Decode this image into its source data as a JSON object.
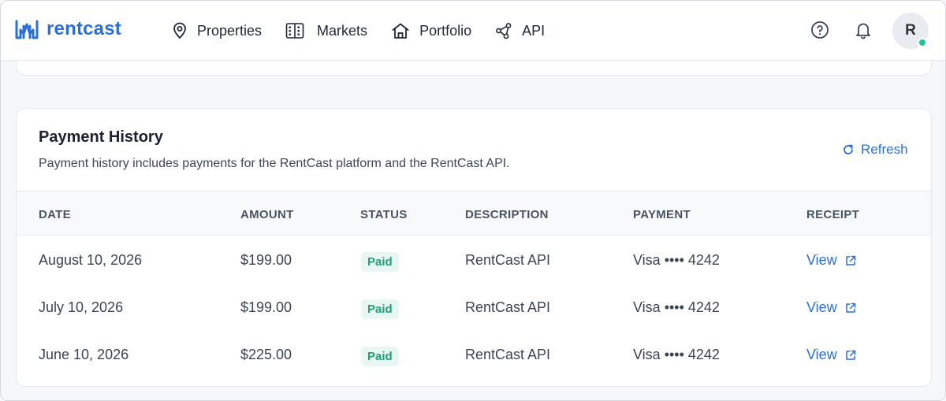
{
  "brand": {
    "name": "rentcast",
    "color": "#2b6fd6"
  },
  "nav": [
    {
      "label": "Properties",
      "icon": "map-pin-icon"
    },
    {
      "label": "Markets",
      "icon": "buildings-icon"
    },
    {
      "label": "Portfolio",
      "icon": "house-icon"
    },
    {
      "label": "API",
      "icon": "api-nodes-icon"
    }
  ],
  "user": {
    "initial": "R",
    "status_color": "#21c29a"
  },
  "payment_history": {
    "title": "Payment History",
    "subtitle": "Payment history includes payments for the RentCast platform and the RentCast API.",
    "refresh_label": "Refresh",
    "columns": [
      "DATE",
      "AMOUNT",
      "STATUS",
      "DESCRIPTION",
      "PAYMENT",
      "RECEIPT"
    ],
    "rows": [
      {
        "date": "August 10, 2026",
        "amount": "$199.00",
        "status": "Paid",
        "description": "RentCast API",
        "payment": "Visa •••• 4242",
        "receipt": "View"
      },
      {
        "date": "July 10, 2026",
        "amount": "$199.00",
        "status": "Paid",
        "description": "RentCast API",
        "payment": "Visa •••• 4242",
        "receipt": "View"
      },
      {
        "date": "June 10, 2026",
        "amount": "$225.00",
        "status": "Paid",
        "description": "RentCast API",
        "payment": "Visa •••• 4242",
        "receipt": "View"
      }
    ]
  }
}
